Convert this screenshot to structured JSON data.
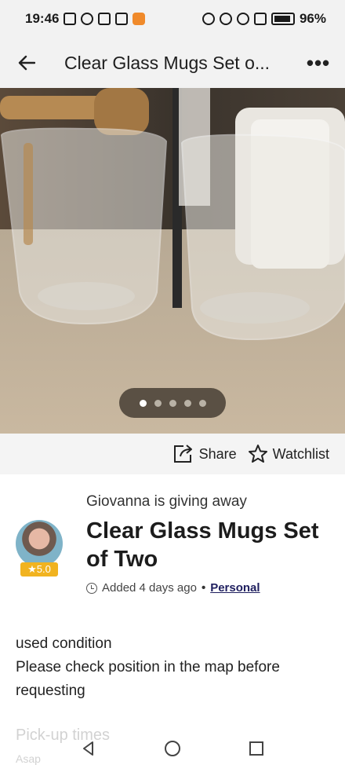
{
  "status_bar": {
    "time": "19:46",
    "battery": "96%"
  },
  "app_bar": {
    "title": "Clear Glass Mugs Set o...",
    "more": "•••"
  },
  "gallery": {
    "image_count": 5,
    "active_index": 0
  },
  "actions": {
    "share_label": "Share",
    "watchlist_label": "Watchlist"
  },
  "listing": {
    "giver_line": "Giovanna is giving away",
    "title": "Clear Glass Mugs Set of Two",
    "rating": "★5.0",
    "added": "Added 4 days ago",
    "category": "Personal",
    "description": [
      "used condition",
      "Please check position in the map before",
      "requesting"
    ],
    "pickup_heading": "Pick-up times",
    "pickup_value": "Asap"
  },
  "colors": {
    "badge": "#f1b320",
    "link": "#1f1f5f"
  }
}
